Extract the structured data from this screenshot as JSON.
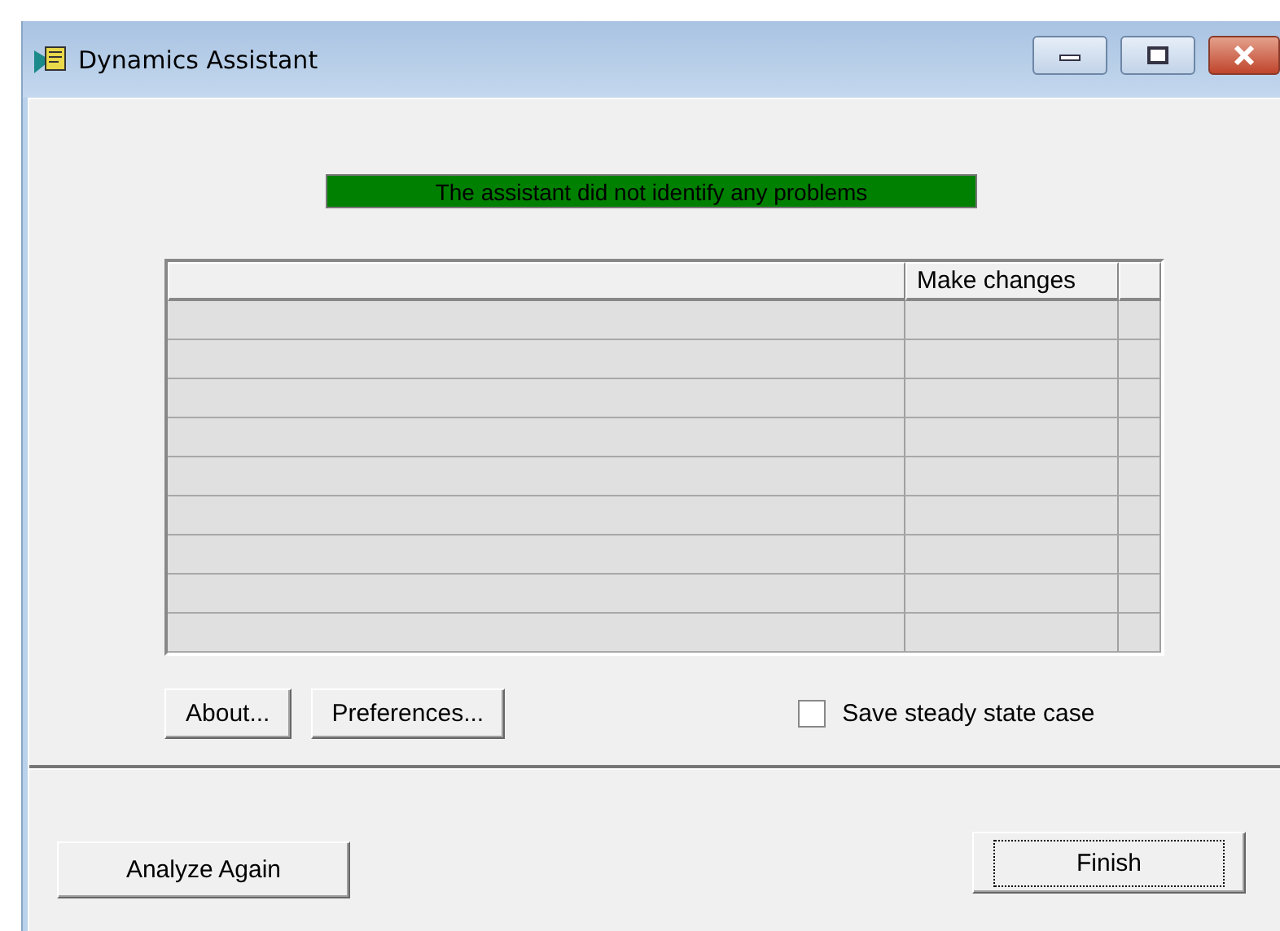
{
  "window": {
    "title": "Dynamics Assistant"
  },
  "status_banner": {
    "text": "The assistant did not identify any problems",
    "color": "#008000"
  },
  "table": {
    "columns": [
      "",
      "Make changes",
      ""
    ]
  },
  "buttons": [
    "About...",
    "Preferences..."
  ],
  "save_steady_state": {
    "label": "Save steady state case",
    "checked": false
  },
  "footer_buttons": [
    {
      "label": "Analyze Again",
      "focused": false
    },
    {
      "label": "Finish",
      "focused": true
    }
  ]
}
